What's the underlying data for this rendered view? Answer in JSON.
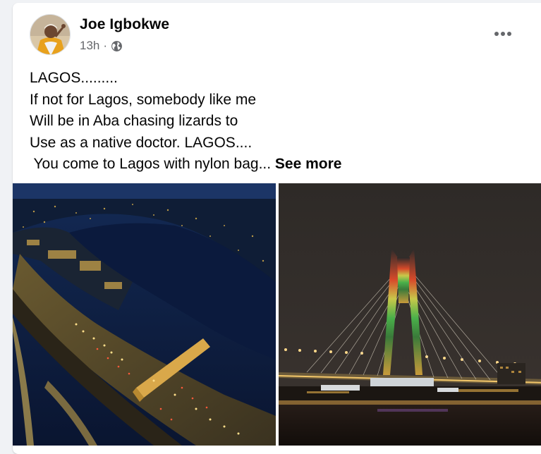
{
  "post": {
    "author": "Joe Igbokwe",
    "time": "13h",
    "separator": "·",
    "privacy_icon": "globe-icon",
    "more_icon": "more-horizontal-icon",
    "text_lines": [
      "LAGOS.........",
      "If not for Lagos, somebody like me",
      "Will be in Aba chasing lizards to",
      "Use as a native doctor. LAGOS....",
      " You come to Lagos with nylon bag..."
    ],
    "see_more": "See more"
  },
  "colors": {
    "page_background": "#f0f2f5",
    "card_background": "#ffffff",
    "primary_text": "#050505",
    "secondary_text": "#65676b"
  }
}
